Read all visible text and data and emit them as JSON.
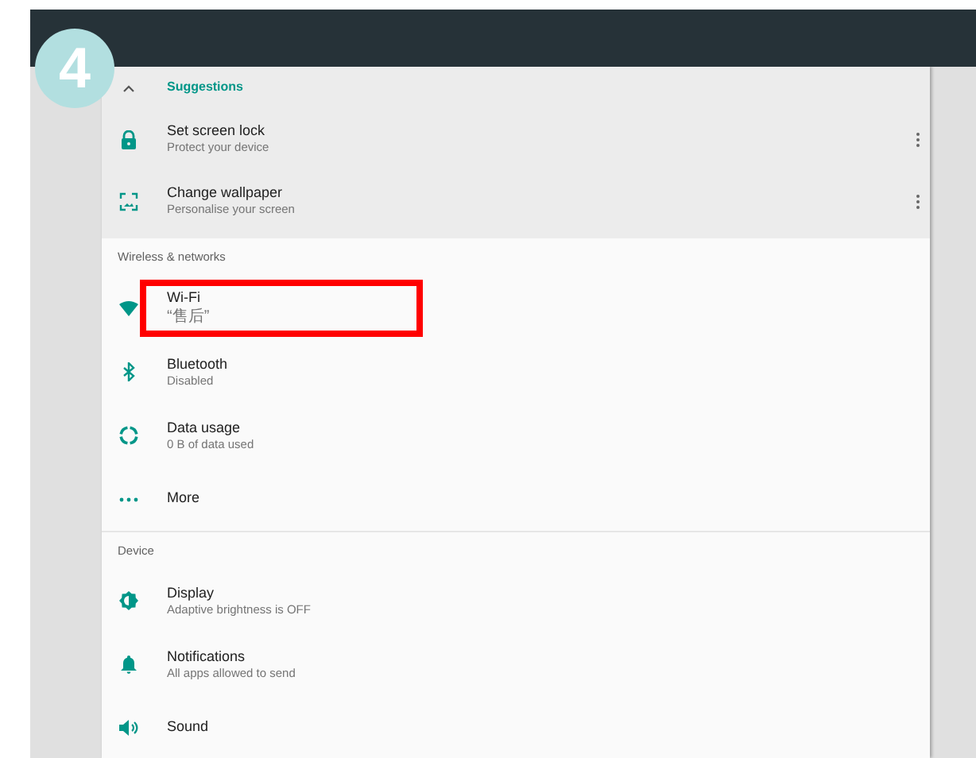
{
  "step_badge": "4",
  "suggestions": {
    "header": "Suggestions",
    "expanded": true,
    "items": [
      {
        "kind": "lock",
        "title": "Set screen lock",
        "subtitle": "Protect your device"
      },
      {
        "kind": "wallpaper",
        "title": "Change wallpaper",
        "subtitle": "Personalise your screen"
      }
    ]
  },
  "sections": [
    {
      "header": "Wireless & networks",
      "items": [
        {
          "kind": "wifi",
          "title": "Wi-Fi",
          "subtitle": "“售后”",
          "highlighted": true
        },
        {
          "kind": "bluetooth",
          "title": "Bluetooth",
          "subtitle": "Disabled",
          "highlighted": false
        },
        {
          "kind": "data",
          "title": "Data usage",
          "subtitle": "0 B of data used",
          "highlighted": false
        },
        {
          "kind": "more",
          "title": "More",
          "highlighted": false
        }
      ]
    },
    {
      "header": "Device",
      "items": [
        {
          "kind": "display",
          "title": "Display",
          "subtitle": "Adaptive brightness is OFF",
          "highlighted": false
        },
        {
          "kind": "bell",
          "title": "Notifications",
          "subtitle": "All apps allowed to send",
          "highlighted": false
        },
        {
          "kind": "sound",
          "title": "Sound",
          "highlighted": false
        }
      ]
    }
  ]
}
